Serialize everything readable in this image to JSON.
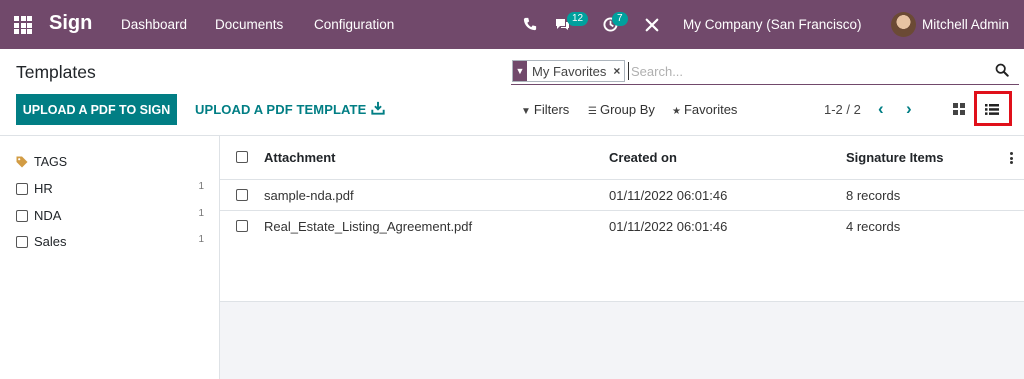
{
  "navbar": {
    "app_name": "Sign",
    "menu": [
      "Dashboard",
      "Documents",
      "Configuration"
    ],
    "messages_count": "12",
    "activities_count": "7",
    "company": "My Company (San Francisco)",
    "user": "Mitchell Admin",
    "icons": [
      "apps-grid-icon",
      "phone-icon",
      "chat-icon",
      "clock-icon",
      "tools-icon"
    ]
  },
  "control_panel": {
    "title": "Templates",
    "search": {
      "facet_label": "My Favorites",
      "facet_remove": "×",
      "placeholder": "Search..."
    },
    "buttons": {
      "upload_pdf": "UPLOAD A PDF TO SIGN",
      "upload_template": "UPLOAD A PDF TEMPLATE"
    },
    "filters": {
      "filters_label": "Filters",
      "group_by_label": "Group By",
      "favorites_label": "Favorites"
    },
    "pager": {
      "value": "1-2 / 2",
      "prev": "‹",
      "next": "›"
    },
    "active_view": "list"
  },
  "sidebar": {
    "header": "TAGS",
    "tags": [
      {
        "label": "HR",
        "count": "1"
      },
      {
        "label": "NDA",
        "count": "1"
      },
      {
        "label": "Sales",
        "count": "1"
      }
    ]
  },
  "table": {
    "columns": [
      "Attachment",
      "Created on",
      "Signature Items"
    ],
    "rows": [
      {
        "attachment": "sample-nda.pdf",
        "created_on": "01/11/2022 06:01:46",
        "signature_items": "8 records"
      },
      {
        "attachment": "Real_Estate_Listing_Agreement.pdf",
        "created_on": "01/11/2022 06:01:46",
        "signature_items": "4 records"
      }
    ]
  },
  "colors": {
    "navbar": "#71496b",
    "primary": "#017e84",
    "badge": "#00a09d",
    "highlight": "#e0101a"
  }
}
